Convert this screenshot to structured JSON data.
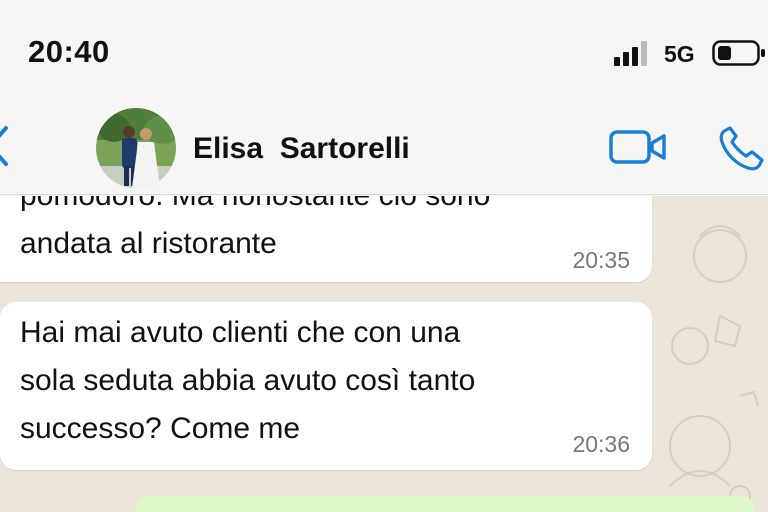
{
  "status_bar": {
    "time": "20:40",
    "network": "5G",
    "icons": [
      "signal-icon",
      "battery-icon"
    ]
  },
  "header": {
    "contact_name": "Elisa  Sartorelli",
    "icons": [
      "back-chevron-icon",
      "avatar",
      "video-call-icon",
      "phone-icon"
    ]
  },
  "messages": [
    {
      "text": "pomodoro. Ma nonostante ciò sono\nandata al ristorante",
      "time": "20:35"
    },
    {
      "text": "Hai mai avuto clienti che con una\nsola seduta abbia avuto così tanto\nsuccesso? Come me",
      "time": "20:36"
    }
  ],
  "colors": {
    "accent": "#1a7fd4",
    "incoming_bubble": "#ffffff",
    "outgoing_bubble": "#dcf8c6",
    "chat_background": "#ebe4d9",
    "timestamp": "#777777"
  }
}
